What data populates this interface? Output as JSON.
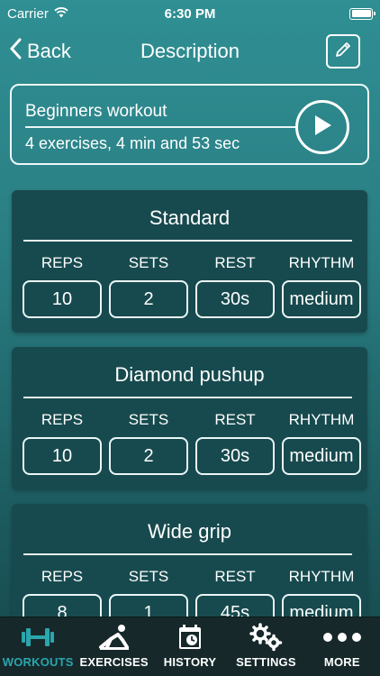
{
  "status_bar": {
    "carrier": "Carrier",
    "time": "6:30 PM",
    "battery_level": 1.0
  },
  "nav": {
    "back_label": "Back",
    "title": "Description"
  },
  "workout": {
    "name": "Beginners workout",
    "meta": "4 exercises, 4 min and 53 sec"
  },
  "columns": [
    "REPS",
    "SETS",
    "REST",
    "RHYTHM"
  ],
  "exercises": [
    {
      "name": "Standard",
      "reps": "10",
      "sets": "2",
      "rest": "30s",
      "rhythm": "medium"
    },
    {
      "name": "Diamond pushup",
      "reps": "10",
      "sets": "2",
      "rest": "30s",
      "rhythm": "medium"
    },
    {
      "name": "Wide grip",
      "reps": "8",
      "sets": "1",
      "rest": "45s",
      "rhythm": "medium"
    }
  ],
  "tabs": [
    {
      "label": "WORKOUTS",
      "icon": "dumbbell-icon",
      "active": true
    },
    {
      "label": "EXERCISES",
      "icon": "exercise-figure-icon",
      "active": false
    },
    {
      "label": "HISTORY",
      "icon": "history-calendar-icon",
      "active": false
    },
    {
      "label": "SETTINGS",
      "icon": "gears-icon",
      "active": false
    },
    {
      "label": "MORE",
      "icon": "more-dots-icon",
      "active": false
    }
  ],
  "colors": {
    "accent": "#2aa6ad",
    "card_bg": "#174a4e",
    "tab_bar_bg": "#16282a"
  }
}
